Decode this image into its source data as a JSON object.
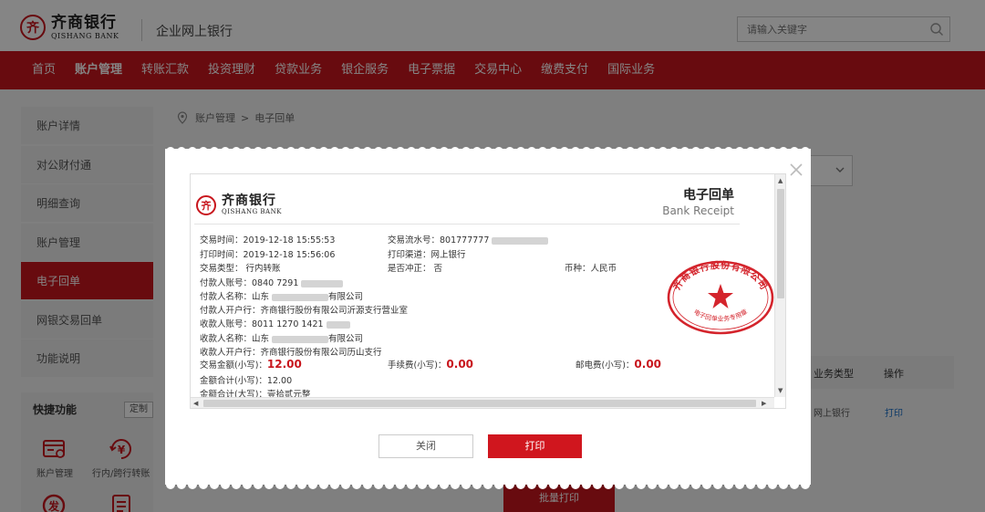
{
  "brand": {
    "name_cn": "齐商银行",
    "name_en": "QISHANG BANK",
    "mark": "齐",
    "subtitle": "企业网上银行",
    "accent_color": "#c8161d"
  },
  "search": {
    "placeholder": "请输入关键字",
    "icon": "search-icon"
  },
  "nav": {
    "items": [
      "首页",
      "账户管理",
      "转账汇款",
      "投资理财",
      "贷款业务",
      "银企服务",
      "电子票据",
      "交易中心",
      "缴费支付",
      "国际业务"
    ],
    "active": "账户管理"
  },
  "sidebar": {
    "items": [
      "账户详情",
      "对公财付通",
      "明细查询",
      "账户管理",
      "电子回单",
      "网银交易回单",
      "功能说明"
    ],
    "active": "电子回单"
  },
  "quick": {
    "title": "快捷功能",
    "set_label": "定制",
    "items": [
      {
        "label": "账户管理",
        "icon": "account-card-icon"
      },
      {
        "label": "行内/跨行转账",
        "icon": "yuan-transfer-icon"
      },
      {
        "label": "",
        "icon": "issue-badge-icon"
      },
      {
        "label": "",
        "icon": "document-list-icon"
      }
    ]
  },
  "breadcrumb": {
    "items": [
      "账户管理",
      "电子回单"
    ],
    "separator": ">"
  },
  "table": {
    "headers": [
      "业务类型",
      "操作"
    ],
    "row": {
      "business_type": "网上银行",
      "action": "打印"
    }
  },
  "batch_print_label": "批量打印",
  "modal": {
    "receipt": {
      "title": "电子回单",
      "subtitle": "Bank Receipt",
      "fields": {
        "trade_time": "交易时间：2019-12-18 15:55:53",
        "serial_no": "交易流水号：801777777",
        "print_time": "打印时间：2019-12-18 15:56:06",
        "print_channel": "打印渠道：网上银行",
        "trade_type": "交易类型： 行内转账",
        "reversal": "是否冲正： 否",
        "currency": "币种：人民币",
        "payer_account": "付款人账号：0840 7291",
        "payer_name_pre": "付款人名称：山东",
        "payer_name_post": "有限公司",
        "payer_bank": "付款人开户行：齐商银行股份有限公司沂源支行营业室",
        "payee_account": "收款人账号：8011 1270 1421",
        "payee_name_pre": "收款人名称：山东",
        "payee_name_post": "有限公司",
        "payee_bank": "收款人开户行：齐商银行股份有限公司历山支行",
        "amount_label": "交易金额(小写)：",
        "amount_value": "12.00",
        "fee_label": "手续费(小写)：",
        "fee_value": "0.00",
        "postage_label": "邮电费(小写)：",
        "postage_value": "0.00",
        "total_small": "金额合计(小写)：12.00",
        "total_big": "金额合计(大写)：壹拾贰元整"
      },
      "stamp": {
        "outer": "齐商银行股份有限公司",
        "inner": "电子回单业务专用章",
        "color": "#d4242c"
      }
    },
    "close_label": "关闭",
    "print_label": "打印"
  }
}
